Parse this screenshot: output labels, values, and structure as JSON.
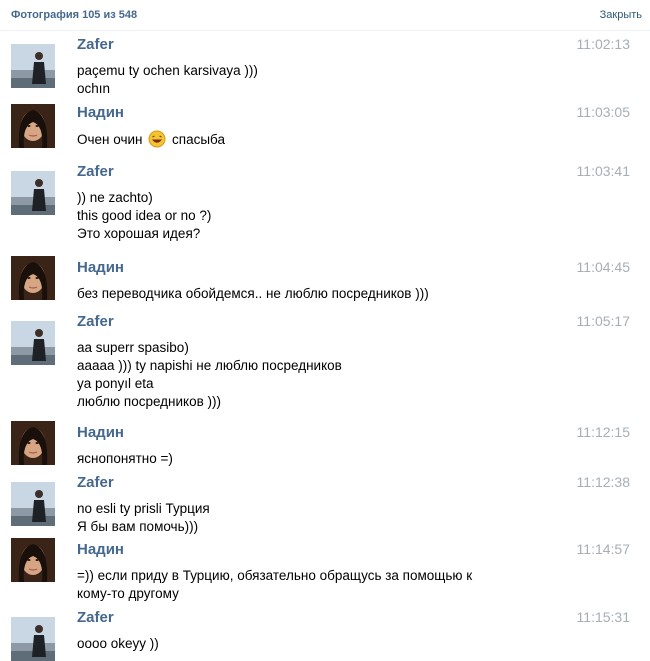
{
  "header": {
    "photo_counter": "Фотография 105 из 548",
    "close_label": "Закрыть"
  },
  "messages": [
    {
      "author": "Zafer",
      "time": "11:02:13",
      "avatar": "zafer",
      "lines": [
        "paçemu ty ochen karsivaya )))",
        "ochın"
      ]
    },
    {
      "author": "Надин",
      "time": "11:03:05",
      "avatar": "nadin",
      "lines": [
        "Очен очин",
        "спасыба"
      ],
      "emoji": "laughing-smiley-icon"
    },
    {
      "author": "Zafer",
      "time": "11:03:41",
      "avatar": "zafer",
      "lines": [
        ")) ne zachto)",
        "this good idea or no ?)",
        "Это хорошая идея?"
      ]
    },
    {
      "author": "Надин",
      "time": "11:04:45",
      "avatar": "nadin",
      "lines": [
        "без переводчика обойдемся.. не люблю посредников )))"
      ]
    },
    {
      "author": "Zafer",
      "time": "11:05:17",
      "avatar": "zafer",
      "lines": [
        "aa superr spasibo)",
        "aaaaa ))) ty napishi не люблю посредников",
        "ya ponyıl eta",
        "люблю посредников )))"
      ]
    },
    {
      "author": "Надин",
      "time": "11:12:15",
      "avatar": "nadin",
      "lines": [
        "яснопонятно =)"
      ]
    },
    {
      "author": "Zafer",
      "time": "11:12:38",
      "avatar": "zafer",
      "lines": [
        "no esli ty prisli Турция",
        "Я бы вам помочь)))"
      ]
    },
    {
      "author": "Надин",
      "time": "11:14:57",
      "avatar": "nadin",
      "lines": [
        "=)) если приду в Турцию, обязательно обращусь за помощью к",
        "кому-то другому"
      ]
    },
    {
      "author": "Zafer",
      "time": "11:15:31",
      "avatar": "zafer",
      "lines": [
        "oooo okeyy ))"
      ]
    }
  ]
}
